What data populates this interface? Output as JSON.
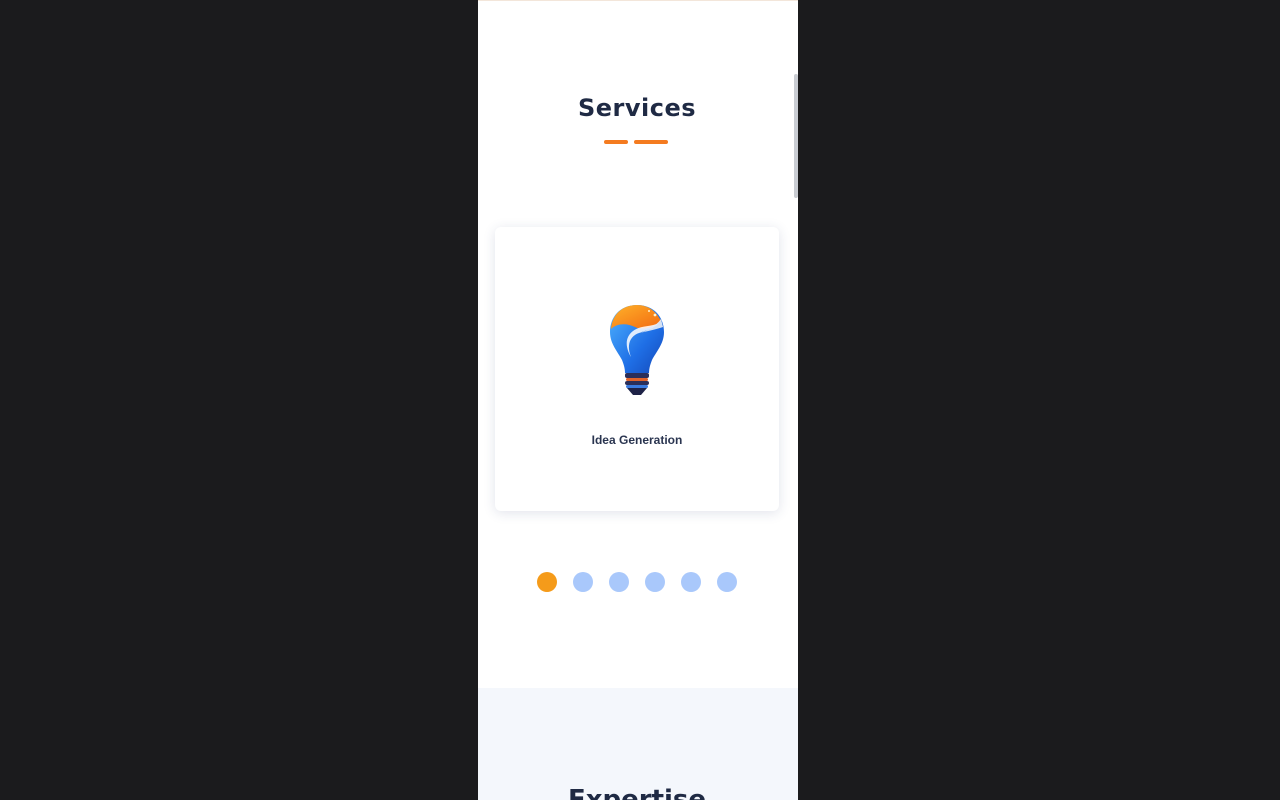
{
  "services": {
    "title": "Services",
    "accent_color": "#f47b20",
    "card": {
      "icon": "lightbulb-icon",
      "label": "Idea Generation"
    },
    "carousel": {
      "total_slides": 6,
      "active_index": 0,
      "active_color": "#f59b1a",
      "inactive_color": "#a9c8fb"
    }
  },
  "expertise": {
    "title": "Expertise"
  }
}
